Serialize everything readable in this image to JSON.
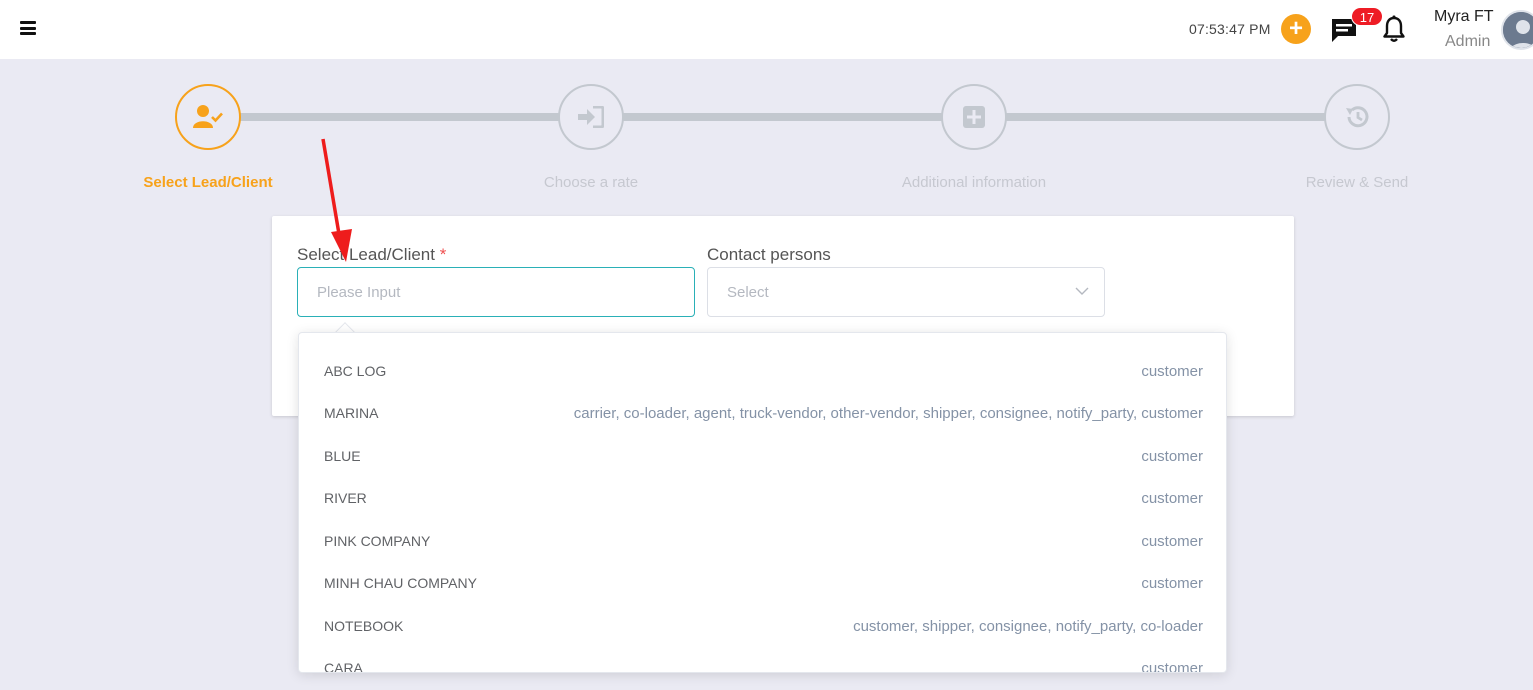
{
  "header": {
    "time": "07:53:47 PM",
    "notification_count": "17",
    "user_name": "Myra FT",
    "user_role": "Admin"
  },
  "stepper": {
    "steps": [
      {
        "label": "Select Lead/Client"
      },
      {
        "label": "Choose a rate"
      },
      {
        "label": "Additional information"
      },
      {
        "label": "Review & Send"
      }
    ]
  },
  "form": {
    "lead_label": "Select Lead/Client",
    "required_mark": "*",
    "lead_placeholder": "Please Input",
    "contact_label": "Contact persons",
    "contact_placeholder": "Select"
  },
  "dropdown": {
    "options": [
      {
        "name": "ABC LOG",
        "type": "customer"
      },
      {
        "name": "MARINA",
        "type": "carrier, co-loader, agent, truck-vendor, other-vendor, shipper, consignee, notify_party, customer"
      },
      {
        "name": "BLUE",
        "type": "customer"
      },
      {
        "name": "RIVER",
        "type": "customer"
      },
      {
        "name": "PINK COMPANY",
        "type": "customer"
      },
      {
        "name": "MINH CHAU COMPANY",
        "type": "customer"
      },
      {
        "name": "NOTEBOOK",
        "type": "customer, shipper, consignee, notify_party, co-loader"
      },
      {
        "name": "CARA",
        "type": "customer"
      }
    ]
  },
  "colors": {
    "accent": "#f7a21b",
    "badge": "#ee1c25",
    "focus": "#2ab0b7",
    "annotation": "#ee1c1c"
  }
}
